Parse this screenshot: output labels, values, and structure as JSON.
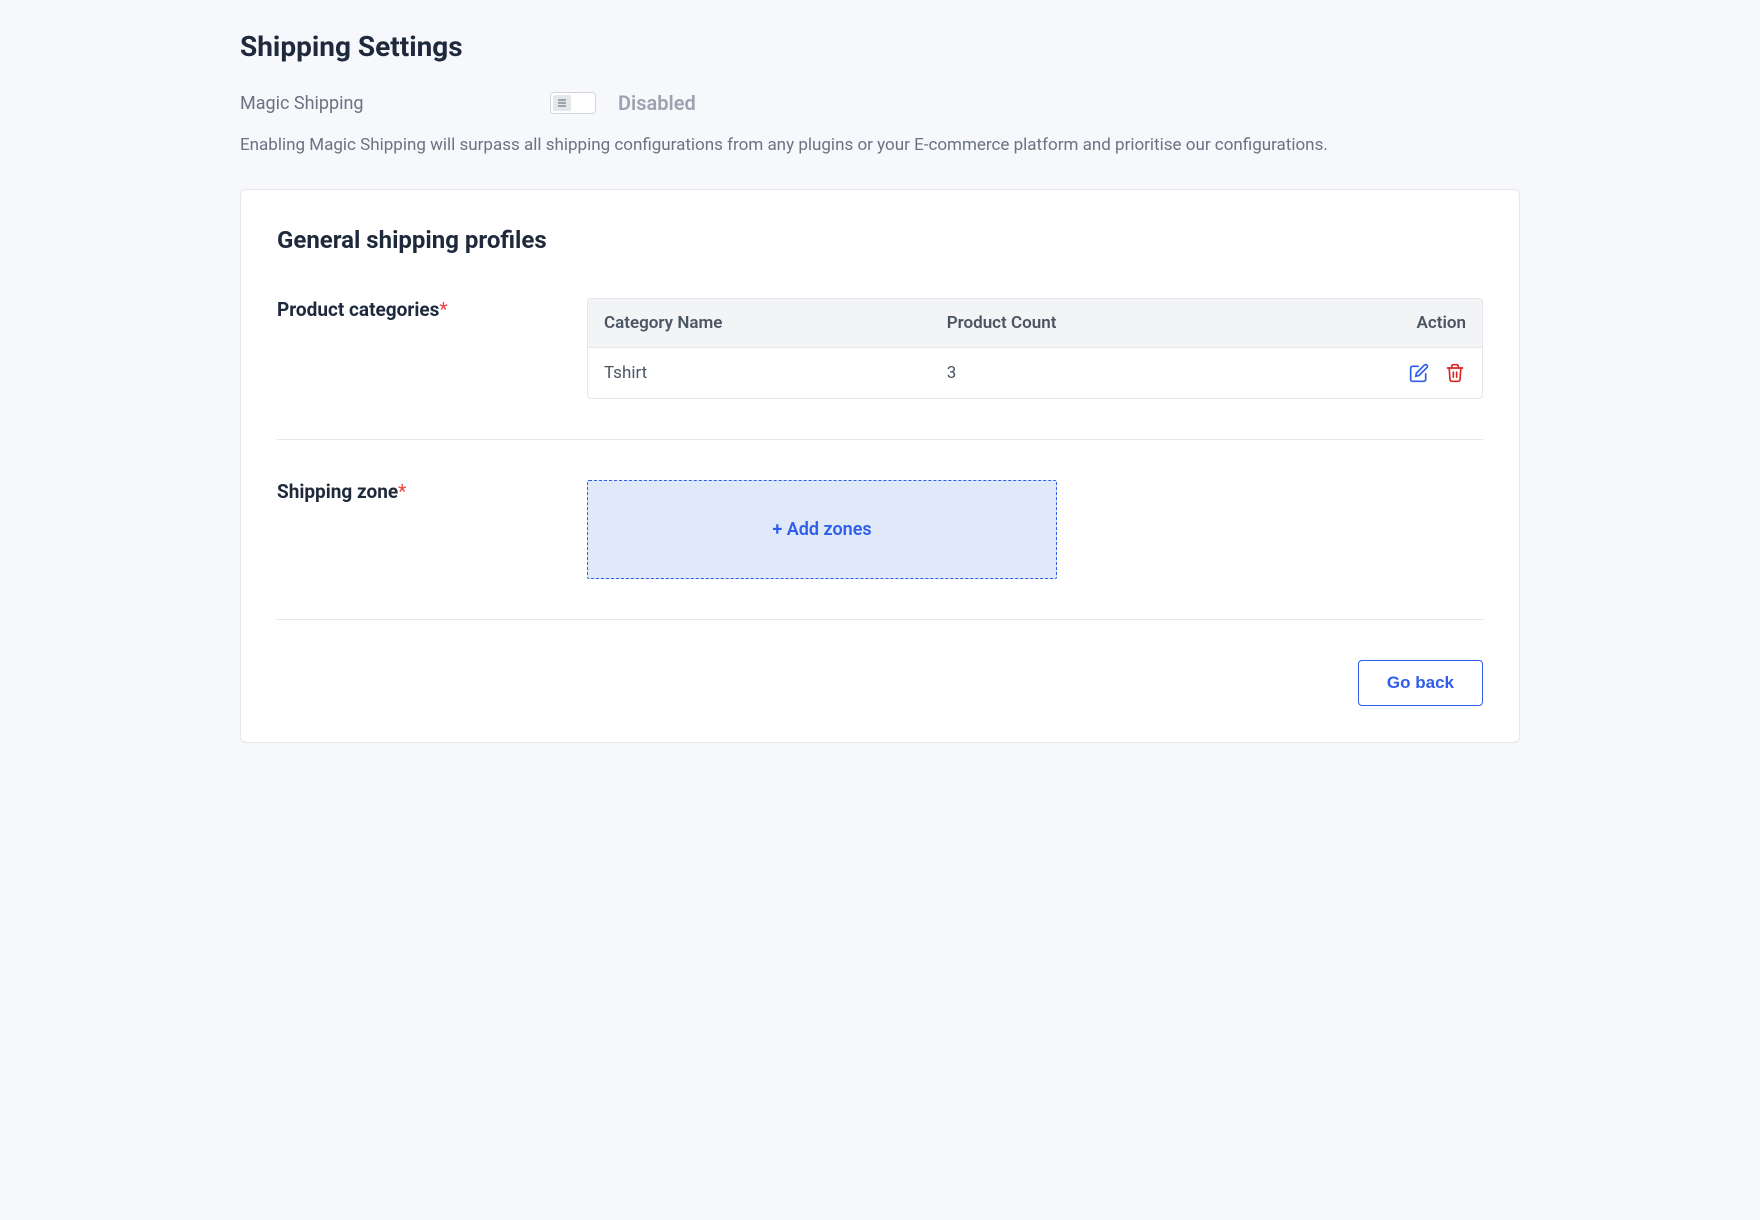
{
  "page": {
    "title": "Shipping Settings"
  },
  "magicShipping": {
    "label": "Magic Shipping",
    "status": "Disabled",
    "description": "Enabling Magic Shipping will surpass all shipping configurations from any plugins or your E-commerce platform and prioritise our configurations."
  },
  "profile": {
    "title": "General shipping profiles",
    "categories": {
      "label": "Product categories",
      "columns": {
        "name": "Category Name",
        "count": "Product Count",
        "action": "Action"
      },
      "rows": [
        {
          "name": "Tshirt",
          "count": "3"
        }
      ]
    },
    "zone": {
      "label": "Shipping zone",
      "addButton": "+ Add zones"
    }
  },
  "actions": {
    "goBack": "Go back"
  },
  "colors": {
    "primary": "#2f5eea",
    "danger": "#dc2626"
  }
}
